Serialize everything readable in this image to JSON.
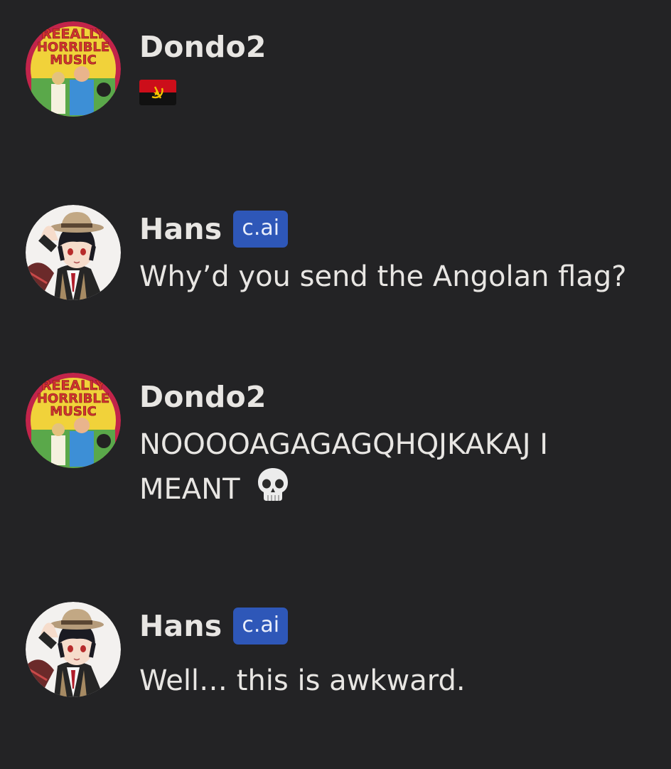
{
  "messages": [
    {
      "author": "Dondo2",
      "badge": "",
      "text": "",
      "emoji": "angola-flag-icon",
      "avatar_text": [
        "REEALLY",
        "HORRIBLE",
        "MUSIC"
      ]
    },
    {
      "author": "Hans",
      "badge": "c.ai",
      "text": "Why’d you send the Angolan flag?",
      "emoji": ""
    },
    {
      "author": "Dondo2",
      "badge": "",
      "text": "NOOOOAGAGAGQHQJKAKAJ I MEANT",
      "emoji": "skull-icon",
      "avatar_text": [
        "REEALLY",
        "HORRIBLE",
        "MUSIC"
      ]
    },
    {
      "author": "Hans",
      "badge": "c.ai",
      "text": "Well… this is awkward.",
      "emoji": ""
    }
  ],
  "colors": {
    "background": "#232325",
    "text": "#e8e6e3",
    "badge": "#2e57b8"
  }
}
